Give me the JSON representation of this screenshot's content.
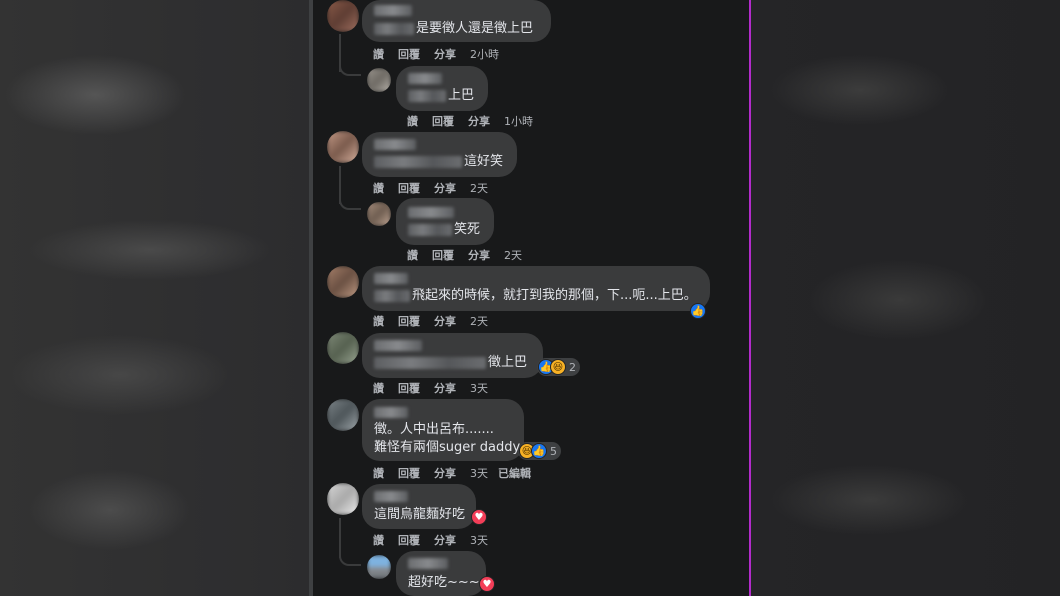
{
  "actions": {
    "like": "讚",
    "reply": "回覆",
    "share": "分享",
    "edited": "已編輯"
  },
  "comments": [
    {
      "text": "是要徵人還是徵上巴",
      "time": "2小時"
    },
    {
      "text": "上巴",
      "time": "1小時"
    },
    {
      "text": "這好笑",
      "time": "2天"
    },
    {
      "text": "笑死",
      "time": "2天"
    },
    {
      "text": "飛起來的時候，就打到我的那個，下...呃...上巴。",
      "time": "2天"
    },
    {
      "text": "徵上巴",
      "time": "3天",
      "reaction_count": "2"
    },
    {
      "text_line1": "徵。人中出呂布.......",
      "text_line2": "難怪有兩個suger daddy",
      "time": "3天",
      "reaction_count": "5"
    },
    {
      "text": "這間烏龍麵好吃",
      "time": "3天"
    },
    {
      "text": "超好吃~~~"
    }
  ],
  "colors": {
    "feed_bg": "#18191a",
    "bubble": "#3a3b3c",
    "text": "#e4e6eb",
    "meta": "#b0b3b8",
    "like_blue": "#1877f2",
    "love_red": "#f33e58",
    "haha_yellow": "#f7b125",
    "purple_guide": "#b22bcb"
  },
  "icons": {
    "like": "like-reaction-icon",
    "haha": "haha-reaction-icon",
    "love": "love-reaction-icon"
  }
}
